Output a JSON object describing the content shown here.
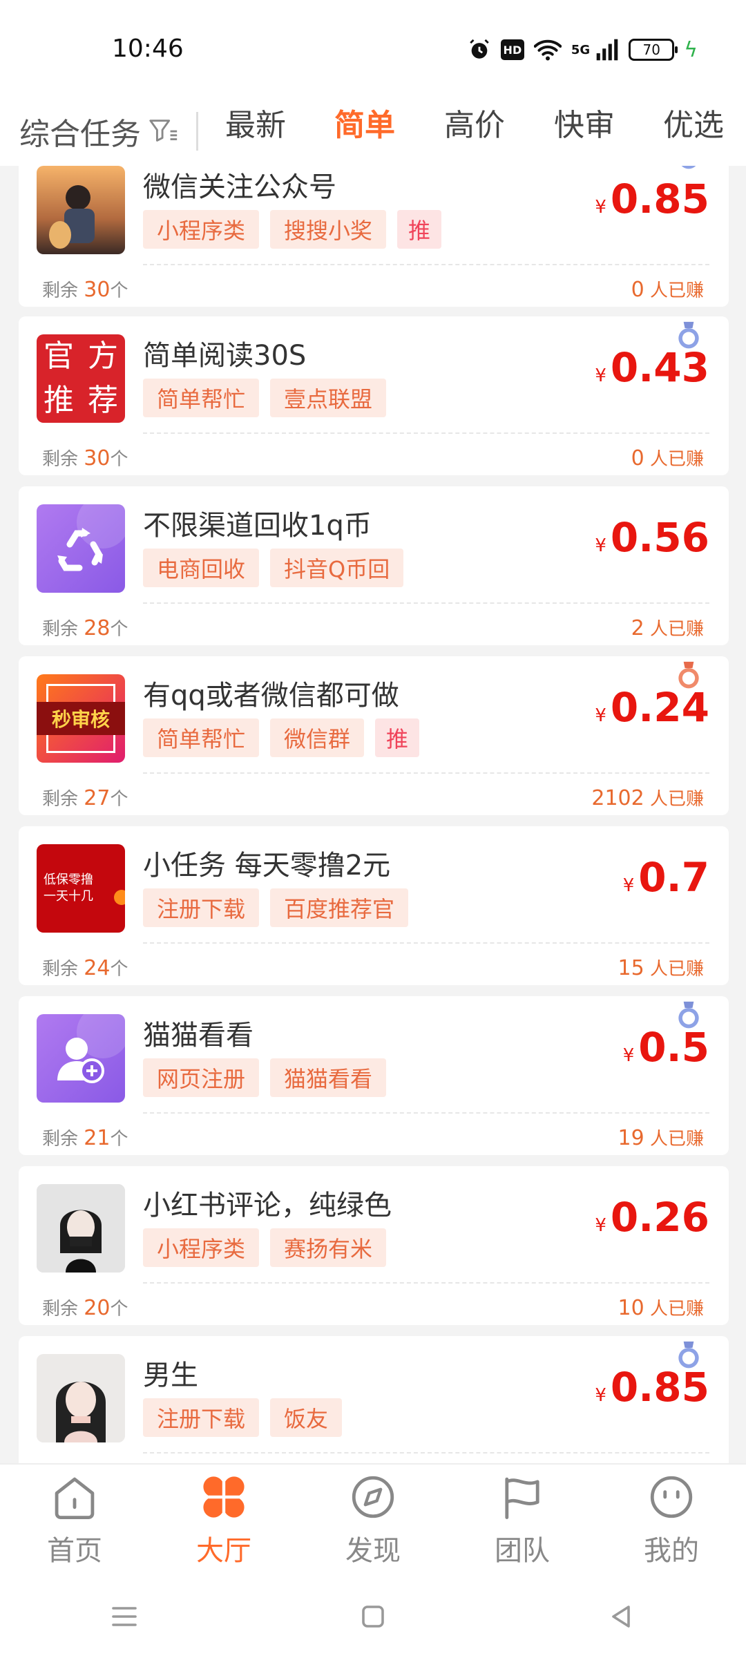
{
  "status": {
    "time": "10:46",
    "battery": "70",
    "hd": "HD",
    "network": "5G"
  },
  "filter": {
    "combo_label": "综合任务",
    "tabs": [
      {
        "label": "最新",
        "active": false
      },
      {
        "label": "简单",
        "active": true
      },
      {
        "label": "高价",
        "active": false
      },
      {
        "label": "快审",
        "active": false
      },
      {
        "label": "优选",
        "active": false
      }
    ]
  },
  "currency_symbol": "¥",
  "remain_prefix": "剩余",
  "remain_suffix": "个",
  "earned_suffix": "人已赚",
  "tasks": [
    {
      "title": "微信关注公众号",
      "tags": [
        "小程序类",
        "搜搜小奖"
      ],
      "recommended": "推",
      "price": "0.85",
      "remaining": "30",
      "earned": "0",
      "medal": "blue",
      "thumb": "anime-boy-dog"
    },
    {
      "title": "简单阅读30S",
      "tags": [
        "简单帮忙",
        "壹点联盟"
      ],
      "recommended": "",
      "price": "0.43",
      "remaining": "30",
      "earned": "0",
      "medal": "blue",
      "thumb": "official-recommend",
      "thumb_text": [
        "官",
        "方",
        "推",
        "荐"
      ]
    },
    {
      "title": "不限渠道回收1q币",
      "tags": [
        "电商回收",
        "抖音Q币回"
      ],
      "recommended": "",
      "price": "0.56",
      "remaining": "28",
      "earned": "2",
      "medal": "",
      "thumb": "recycle-icon"
    },
    {
      "title": "有qq或者微信都可做",
      "tags": [
        "简单帮忙",
        "微信群"
      ],
      "recommended": "推",
      "price": "0.24",
      "remaining": "27",
      "earned": "2102",
      "medal": "red",
      "thumb": "fast-review",
      "thumb_text": "秒审核"
    },
    {
      "title": "小任务 每天零撸2元",
      "tags": [
        "注册下载",
        "百度推荐官"
      ],
      "recommended": "",
      "price": "0.7",
      "remaining": "24",
      "earned": "15",
      "medal": "",
      "thumb": "red-promo",
      "thumb_text": [
        "低保零撸",
        "一天十几"
      ]
    },
    {
      "title": "猫猫看看",
      "tags": [
        "网页注册",
        "猫猫看看"
      ],
      "recommended": "",
      "price": "0.5",
      "remaining": "21",
      "earned": "19",
      "medal": "blue",
      "thumb": "add-user-icon"
    },
    {
      "title": "小红书评论，纯绿色",
      "tags": [
        "小程序类",
        "赛扬有米"
      ],
      "recommended": "",
      "price": "0.26",
      "remaining": "20",
      "earned": "10",
      "medal": "",
      "thumb": "girl-photo"
    },
    {
      "title": "男生",
      "tags": [
        "注册下载",
        "饭友"
      ],
      "recommended": "",
      "price": "0.85",
      "remaining": "",
      "earned": "",
      "medal": "blue",
      "thumb": "girl-photo-2"
    }
  ],
  "bottom_nav": [
    {
      "label": "首页",
      "icon": "home-icon",
      "active": false
    },
    {
      "label": "大厅",
      "icon": "hall-icon",
      "active": true
    },
    {
      "label": "发现",
      "icon": "compass-icon",
      "active": false
    },
    {
      "label": "团队",
      "icon": "flag-icon",
      "active": false
    },
    {
      "label": "我的",
      "icon": "smile-icon",
      "active": false
    }
  ],
  "colors": {
    "accent": "#ff6a2a",
    "price": "#e8160f",
    "tag_bg": "#fdeae3",
    "tag_text": "#e86a3f"
  }
}
